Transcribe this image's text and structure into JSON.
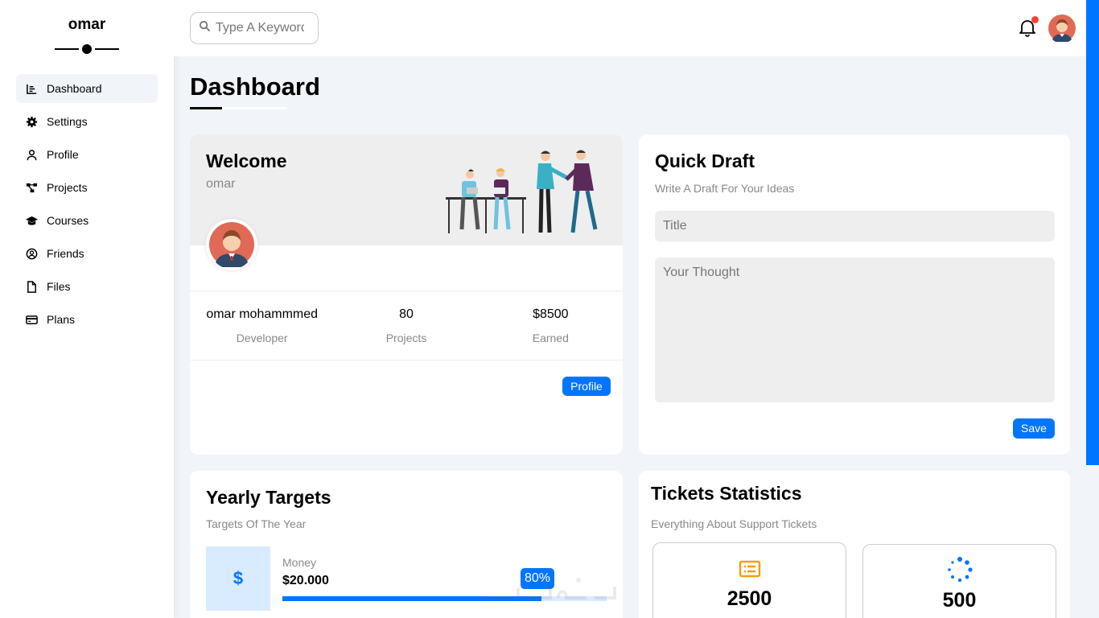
{
  "sidebar": {
    "brand": "omar",
    "items": [
      {
        "label": "Dashboard",
        "icon": "chart-icon",
        "active": true
      },
      {
        "label": "Settings",
        "icon": "gear-icon"
      },
      {
        "label": "Profile",
        "icon": "user-icon"
      },
      {
        "label": "Projects",
        "icon": "diagram-icon"
      },
      {
        "label": "Courses",
        "icon": "graduation-cap-icon"
      },
      {
        "label": "Friends",
        "icon": "user-circle-icon"
      },
      {
        "label": "Files",
        "icon": "file-icon"
      },
      {
        "label": "Plans",
        "icon": "credit-card-icon"
      }
    ]
  },
  "header": {
    "search_placeholder": "Type A Keyword",
    "notification": true
  },
  "page": {
    "title": "Dashboard"
  },
  "welcome": {
    "title": "Welcome",
    "username": "omar",
    "stats": [
      {
        "value": "omar mohammmed",
        "label": "Developer"
      },
      {
        "value": "80",
        "label": "Projects"
      },
      {
        "value": "$8500",
        "label": "Earned"
      }
    ],
    "button": "Profile"
  },
  "draft": {
    "title": "Quick Draft",
    "subtitle": "Write A Draft For Your Ideas",
    "title_placeholder": "Title",
    "thought_placeholder": "Your Thought",
    "button": "Save"
  },
  "targets": {
    "title": "Yearly Targets",
    "subtitle": "Targets Of The Year",
    "item": {
      "icon": "$",
      "label": "Money",
      "value": "$20.000",
      "percent_label": "80%",
      "progress": 0.8
    }
  },
  "tickets": {
    "title": "Tickets Statistics",
    "subtitle": "Everything About Support Tickets",
    "boxes": [
      {
        "icon": "ticket-icon",
        "value": "2500",
        "color": "#f59e0b"
      },
      {
        "icon": "spinner-icon",
        "value": "500",
        "color": "#0075ff"
      }
    ]
  },
  "colors": {
    "accent": "#0075ff",
    "background": "#f1f5f9",
    "badge": "#f44336"
  }
}
